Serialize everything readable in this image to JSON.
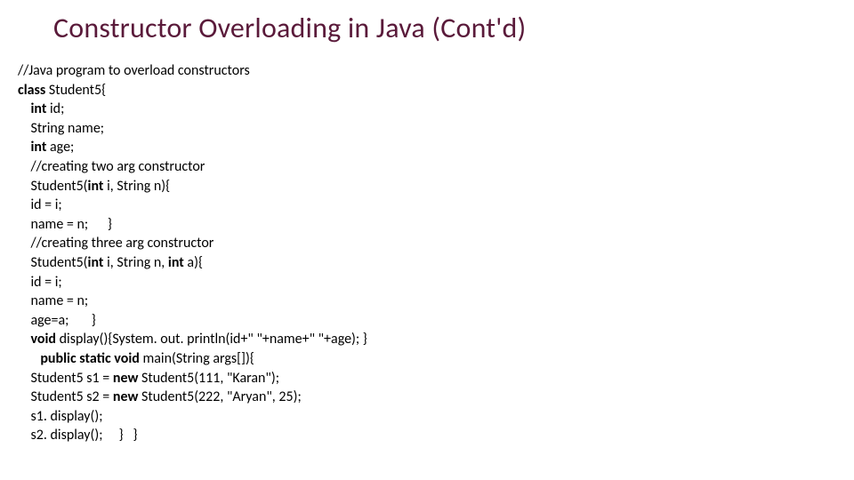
{
  "title": "Constructor Overloading in Java (Cont'd)",
  "code": {
    "l01": "//Java program to overload constructors",
    "l02a": "class",
    "l02b": " Student5{",
    "l03a": "    int",
    "l03b": " id;",
    "l04": "    String name;",
    "l05a": "    int",
    "l05b": " age;",
    "l06": "    //creating two arg constructor",
    "l07a": "    Student5(",
    "l07b": "int",
    "l07c": " i, String n){",
    "l08": "    id = i;",
    "l09": "    name = n;      }",
    "l10": "    //creating three arg constructor",
    "l11a": "    Student5(",
    "l11b": "int",
    "l11c": " i, String n, ",
    "l11d": "int",
    "l11e": " a){",
    "l12": "    id = i;",
    "l13": "    name = n;",
    "l14": "    age=a;       }",
    "l15a": "    void",
    "l15b": " display(){System. out. println(id+\" \"+name+\" \"+age); }",
    "l16a": "       public",
    "l16b": " static",
    "l16c": " void",
    "l16d": " main(String args[]){",
    "l17a": "    Student5 s1 = ",
    "l17b": "new",
    "l17c": " Student5(111, \"Karan\");",
    "l18a": "    Student5 s2 = ",
    "l18b": "new",
    "l18c": " Student5(222, \"Aryan\", 25);",
    "l19": "    s1. display();",
    "l20": "    s2. display();     }   }"
  }
}
